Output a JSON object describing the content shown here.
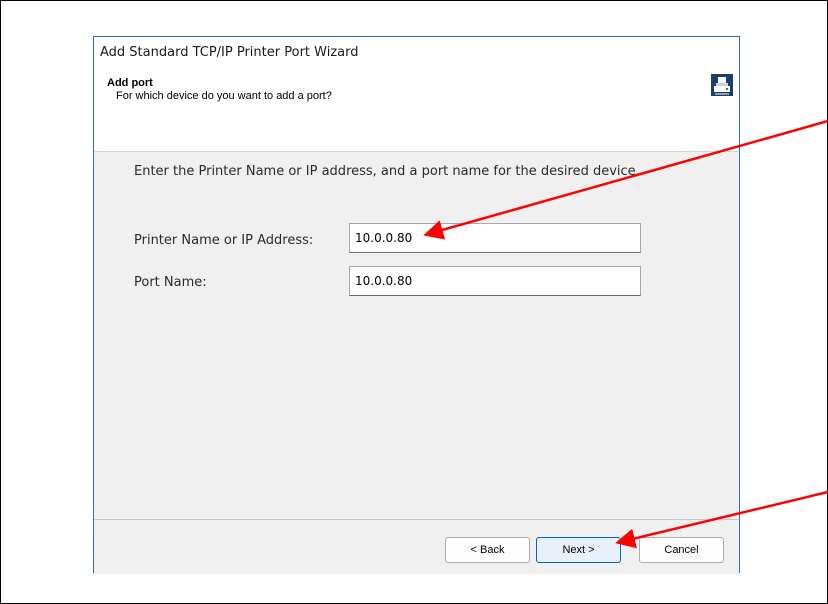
{
  "window": {
    "title": "Add Standard TCP/IP Printer Port Wizard"
  },
  "header": {
    "title": "Add port",
    "subtitle": "For which device do you want to add a port?",
    "icon": "printer-port-icon"
  },
  "main": {
    "instruction": "Enter the Printer Name or IP address, and a port name for the desired device.",
    "printer_name": {
      "label": "Printer Name or IP Address:",
      "value": "10.0.0.80"
    },
    "port_name": {
      "label": "Port Name:",
      "value": "10.0.0.80"
    }
  },
  "footer": {
    "back_label": "< Back",
    "next_label": "Next >",
    "cancel_label": "Cancel"
  },
  "annotations": {
    "arrow_color": "#ff0000"
  }
}
